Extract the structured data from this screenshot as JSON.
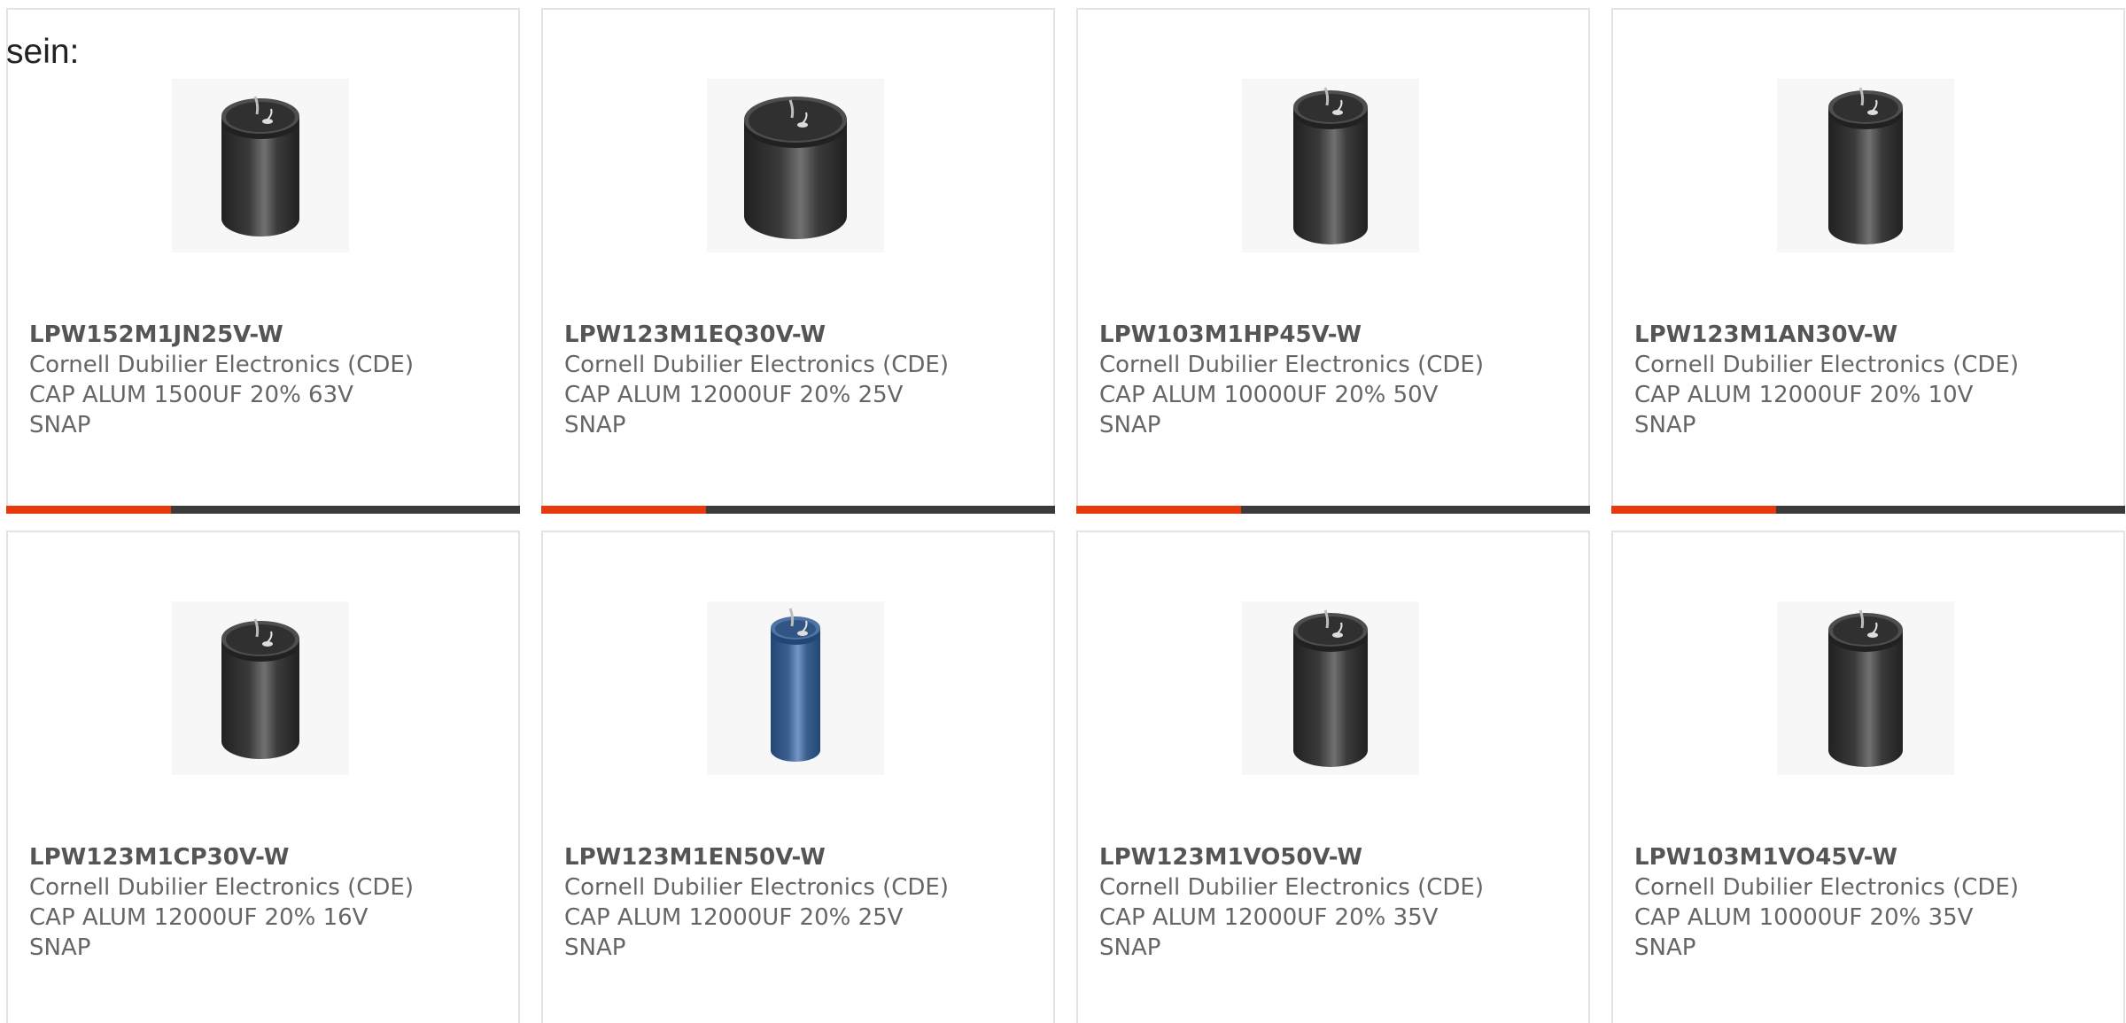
{
  "intro_text": "sein:",
  "accent_color": "#e8380d",
  "track_color": "#3b3b3b",
  "products": [
    {
      "part_number": "LPW152M1JN25V-W",
      "manufacturer": "Cornell Dubilier Electronics (CDE)",
      "description": "CAP ALUM 1500UF 20% 63V SNAP",
      "image_icon": "black-snap-in-capacitor-icon",
      "body_color": "#3a3a3a",
      "progress_fraction": 0.32
    },
    {
      "part_number": "LPW123M1EQ30V-W",
      "manufacturer": "Cornell Dubilier Electronics (CDE)",
      "description": "CAP ALUM 12000UF 20% 25V SNAP",
      "image_icon": "black-snap-in-capacitor-icon",
      "body_color": "#3a3a3a",
      "progress_fraction": 0.32
    },
    {
      "part_number": "LPW103M1HP45V-W",
      "manufacturer": "Cornell Dubilier Electronics (CDE)",
      "description": "CAP ALUM 10000UF 20% 50V SNAP",
      "image_icon": "black-snap-in-capacitor-icon",
      "body_color": "#3a3a3a",
      "progress_fraction": 0.32
    },
    {
      "part_number": "LPW123M1AN30V-W",
      "manufacturer": "Cornell Dubilier Electronics (CDE)",
      "description": "CAP ALUM 12000UF 20% 10V SNAP",
      "image_icon": "black-snap-in-capacitor-icon",
      "body_color": "#3a3a3a",
      "progress_fraction": 0.32
    },
    {
      "part_number": "LPW123M1CP30V-W",
      "manufacturer": "Cornell Dubilier Electronics (CDE)",
      "description": "CAP ALUM 12000UF 20% 16V SNAP",
      "image_icon": "black-snap-in-capacitor-icon",
      "body_color": "#3a3a3a"
    },
    {
      "part_number": "LPW123M1EN50V-W",
      "manufacturer": "Cornell Dubilier Electronics (CDE)",
      "description": "CAP ALUM 12000UF 20% 25V SNAP",
      "image_icon": "blue-snap-in-capacitor-icon",
      "body_color": "#3b5f8f"
    },
    {
      "part_number": "LPW123M1VO50V-W",
      "manufacturer": "Cornell Dubilier Electronics (CDE)",
      "description": "CAP ALUM 12000UF 20% 35V SNAP",
      "image_icon": "black-snap-in-capacitor-icon",
      "body_color": "#3a3a3a"
    },
    {
      "part_number": "LPW103M1VO45V-W",
      "manufacturer": "Cornell Dubilier Electronics (CDE)",
      "description": "CAP ALUM 10000UF 20% 35V SNAP",
      "image_icon": "black-snap-in-capacitor-icon",
      "body_color": "#3a3a3a"
    }
  ]
}
